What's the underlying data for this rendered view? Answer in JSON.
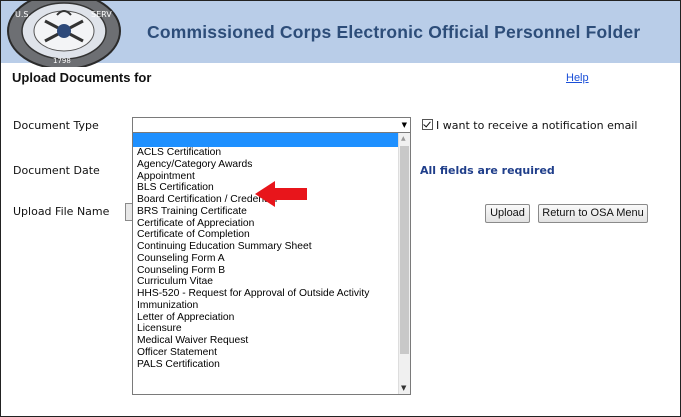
{
  "banner": {
    "title": "Commissioned Corps Electronic  Official Personnel Folder"
  },
  "page": {
    "heading": "Upload Documents for",
    "help_link": "Help",
    "required_note": "All fields are required"
  },
  "form": {
    "document_type_label": "Document Type",
    "document_date_label": "Document Date",
    "upload_file_label": "Upload File Name",
    "document_type_value": "",
    "notify_label": "I want to receive a notification email",
    "notify_checked": true
  },
  "buttons": {
    "upload": "Upload",
    "return": "Return to OSA Menu"
  },
  "dropdown": {
    "options": [
      "ACLS Certification",
      "Agency/Category Awards",
      "Appointment",
      "BLS Certification",
      "Board Certification / Credential",
      "BRS Training Certificate",
      "Certificate of Appreciation",
      "Certificate of Completion",
      "Continuing Education Summary Sheet",
      "Counseling Form A",
      "Counseling Form B",
      "Curriculum Vitae",
      "HHS-520 - Request for Approval of Outside Activity",
      "Immunization",
      "Letter of Appreciation",
      "Licensure",
      "Medical Waiver Request",
      "Officer Statement",
      "PALS Certification"
    ]
  },
  "colors": {
    "banner_bg": "#b9cde8",
    "banner_text": "#2d4d79",
    "highlight": "#1e90ff",
    "annotation_arrow": "#e8151b"
  },
  "icons": {
    "seal": "usphs-seal-icon",
    "annotation": "red-arrow-icon"
  }
}
